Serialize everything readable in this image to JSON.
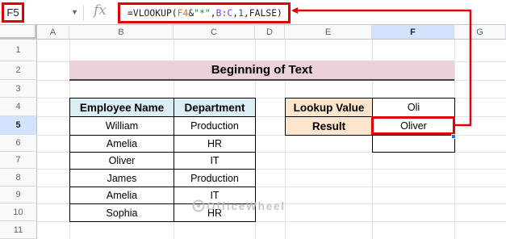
{
  "formula_bar": {
    "name_box": "F5",
    "fx_label": "fx",
    "formula": {
      "f1": "=VLOOKUP(",
      "ref1": "F4",
      "f2": "&",
      "str": "\"*\"",
      "f3": ",",
      "ref2": "B:C",
      "f4": ",",
      "num": "1",
      "f5": ",FALSE)"
    }
  },
  "column_headers": [
    "A",
    "B",
    "C",
    "D",
    "E",
    "F",
    "G"
  ],
  "row_headers": [
    "1",
    "2",
    "3",
    "4",
    "5",
    "6",
    "7",
    "8",
    "9",
    "10",
    "11"
  ],
  "selected_cell": {
    "column": "F",
    "row": "5"
  },
  "sheet": {
    "title": "Beginning of Text",
    "table": {
      "headers": [
        "Employee Name",
        "Department"
      ],
      "rows": [
        [
          "William",
          "Production"
        ],
        [
          "Amelia",
          "HR"
        ],
        [
          "Oliver",
          "IT"
        ],
        [
          "James",
          "Production"
        ],
        [
          "Amelia",
          "IT"
        ],
        [
          "Sophia",
          "HR"
        ]
      ]
    },
    "lookup": {
      "value_label": "Lookup Value",
      "value": "Oli",
      "result_label": "Result",
      "result": "Oliver"
    }
  },
  "annotation_color": "#e00000",
  "watermark": "OfficeWheel"
}
